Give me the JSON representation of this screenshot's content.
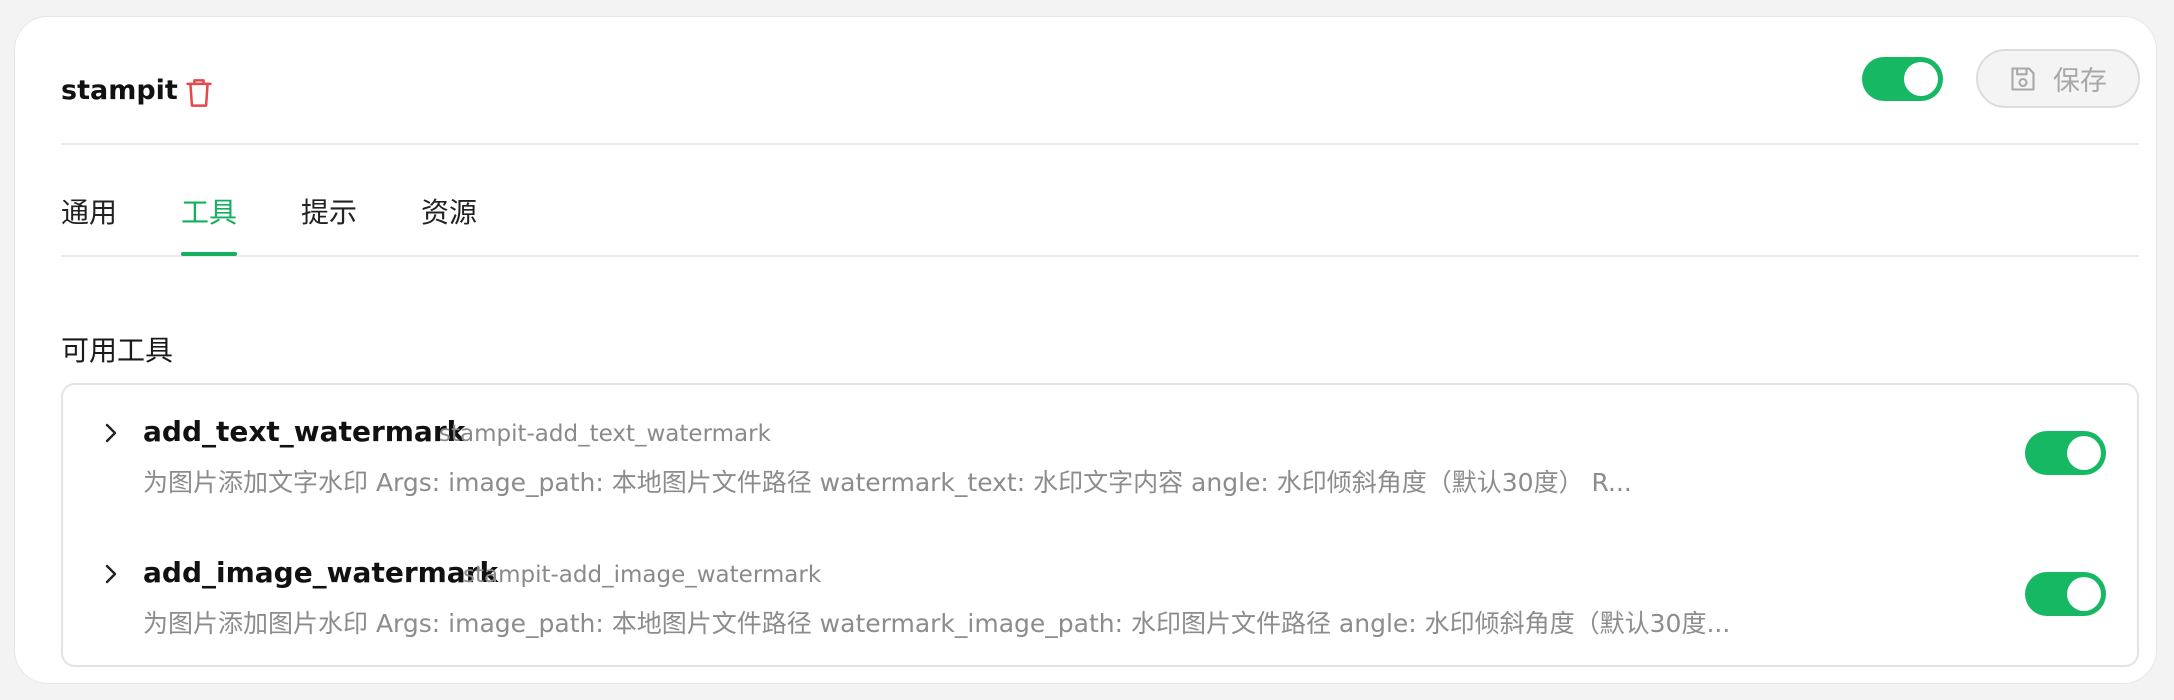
{
  "header": {
    "title": "stampit",
    "save_label": "保存",
    "enabled": true
  },
  "tabs": [
    {
      "label": "通用",
      "active": false
    },
    {
      "label": "工具",
      "active": true
    },
    {
      "label": "提示",
      "active": false
    },
    {
      "label": "资源",
      "active": false
    }
  ],
  "tools_section": {
    "title": "可用工具",
    "tools": [
      {
        "name": "add_text_watermark",
        "id": "stampit-add_text_watermark",
        "description": "为图片添加文字水印 Args: image_path: 本地图片文件路径 watermark_text: 水印文字内容 angle: 水印倾斜角度（默认30度） R...",
        "enabled": true
      },
      {
        "name": "add_image_watermark",
        "id": "stampit-add_image_watermark",
        "description": "为图片添加图片水印 Args: image_path: 本地图片文件路径 watermark_image_path: 水印图片文件路径 angle: 水印倾斜角度（默认30度...",
        "enabled": true
      }
    ]
  },
  "icons": {
    "delete": "trash-icon",
    "save": "save-icon",
    "expand": "chevron-right-icon"
  },
  "colors": {
    "accent": "#14b060",
    "danger": "#e5484d"
  }
}
